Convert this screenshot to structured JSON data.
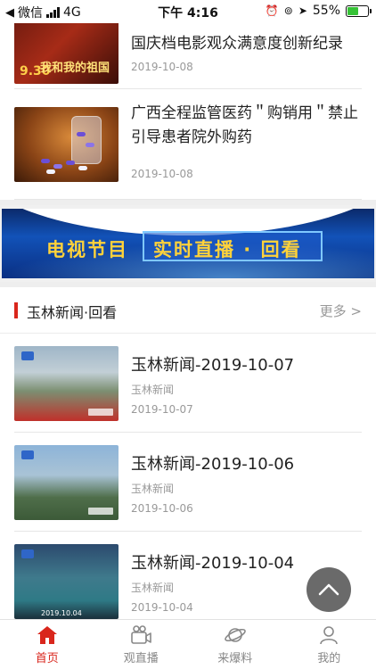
{
  "status_bar": {
    "carrier": "微信",
    "network": "4G",
    "time": "下午 4:16",
    "battery_percent": "55%",
    "battery_level": 0.55
  },
  "news_list": [
    {
      "title": "国庆档电影观众满意度创新纪录",
      "date": "2019-10-08",
      "thumb_text": [
        "9.30",
        "我和我的祖国"
      ]
    },
    {
      "title": "广西全程监管医药＂购销用＂禁止引导患者院外购药",
      "date": "2019-10-08"
    }
  ],
  "banner": {
    "left_text": "电视节目",
    "right_text": "实时直播 · 回看"
  },
  "section": {
    "title": "玉林新闻·回看",
    "more": "更多 >"
  },
  "video_list": [
    {
      "title": "玉林新闻-2019-10-07",
      "source": "玉林新闻",
      "date": "2019-10-07"
    },
    {
      "title": "玉林新闻-2019-10-06",
      "source": "玉林新闻",
      "date": "2019-10-06"
    },
    {
      "title": "玉林新闻-2019-10-04",
      "source": "玉林新闻",
      "date": "2019-10-04",
      "thumb_text": "2019.10.04"
    }
  ],
  "tab_bar": [
    {
      "label": "首页",
      "icon": "home-icon",
      "active": true
    },
    {
      "label": "观直播",
      "icon": "video-camera-icon",
      "active": false
    },
    {
      "label": "来爆料",
      "icon": "planet-icon",
      "active": false
    },
    {
      "label": "我的",
      "icon": "user-icon",
      "active": false
    }
  ],
  "colors": {
    "accent": "#d9261c",
    "tab_inactive": "#888888",
    "date_gray": "#999999"
  }
}
